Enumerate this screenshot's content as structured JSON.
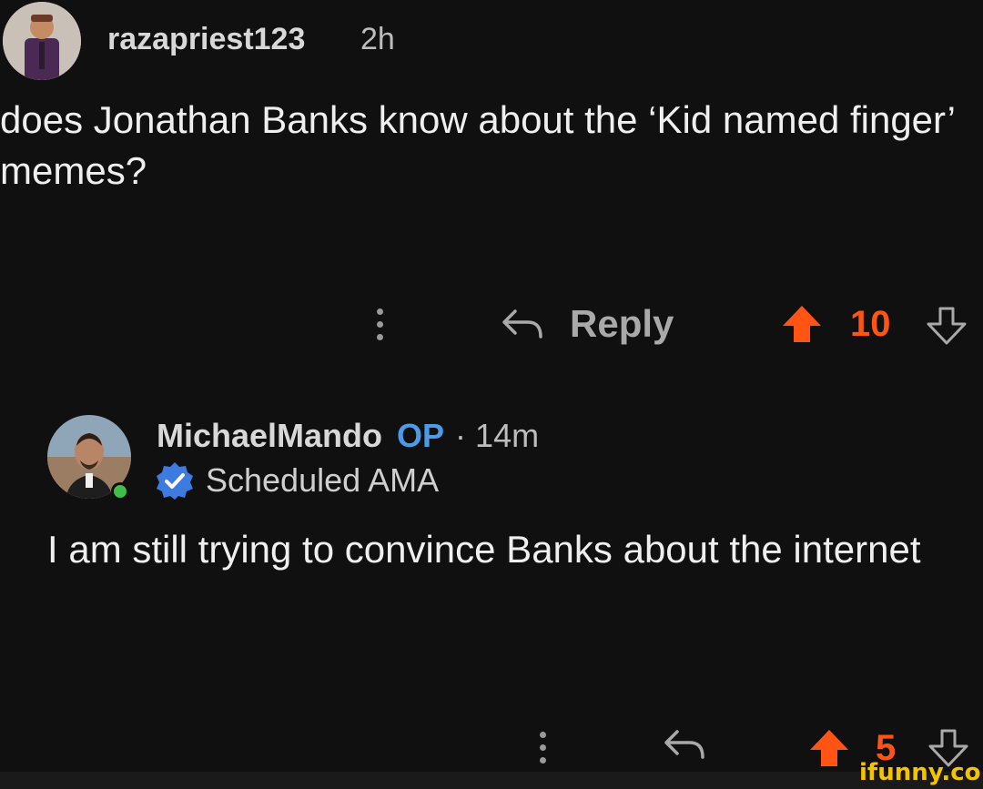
{
  "post": {
    "username": "razapriest123",
    "time": "2h",
    "text": "does Jonathan Banks know about the ‘Kid named finger’ memes?",
    "actions": {
      "more_icon": "kebab-icon",
      "reply_label": "Reply",
      "votes": "10",
      "accent_color": "#ff5414"
    }
  },
  "reply": {
    "username": "MichaelMando",
    "op_badge": "OP",
    "separator": "·",
    "time": "14m",
    "flair": "Scheduled AMA",
    "text": "I am still trying to convince Banks about the internet",
    "actions": {
      "more_icon": "kebab-icon",
      "votes": "5"
    }
  },
  "watermark": "ifunny.co"
}
